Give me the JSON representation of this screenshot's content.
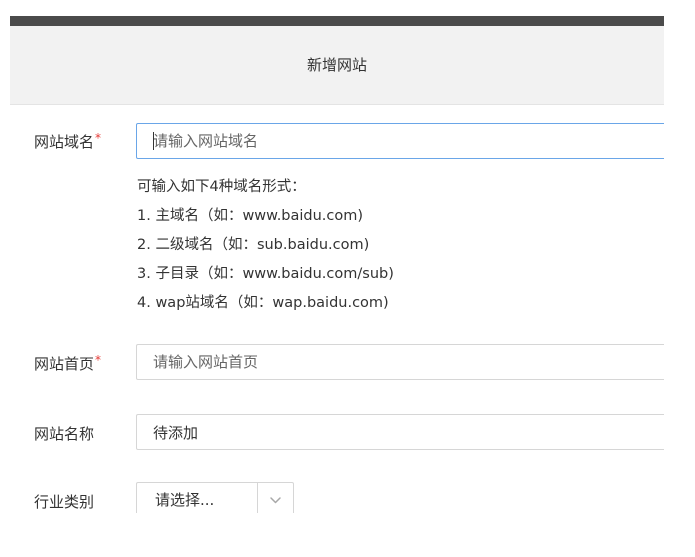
{
  "dialog": {
    "title": "新增网站"
  },
  "form": {
    "domain": {
      "label": "网站域名",
      "required_mark": "*",
      "placeholder": "请输入网站域名",
      "value": ""
    },
    "domain_hint": {
      "intro": "可输入如下4种域名形式：",
      "items": [
        "1. 主域名（如：www.baidu.com)",
        "2. 二级域名（如：sub.baidu.com)",
        "3. 子目录（如：www.baidu.com/sub)",
        "4. wap站域名（如：wap.baidu.com)"
      ]
    },
    "homepage": {
      "label": "网站首页",
      "required_mark": "*",
      "placeholder": "请输入网站首页",
      "value": ""
    },
    "site_name": {
      "label": "网站名称",
      "value": "待添加"
    },
    "industry": {
      "label": "行业类别",
      "selected": "请选择..."
    }
  },
  "icons": {
    "select_arrow": "chevron-down-icon"
  },
  "colors": {
    "required": "#e53935",
    "focus_border": "#6aa6e8",
    "header_bg": "#f2f2f2",
    "top_bar": "#4b4b4b"
  }
}
